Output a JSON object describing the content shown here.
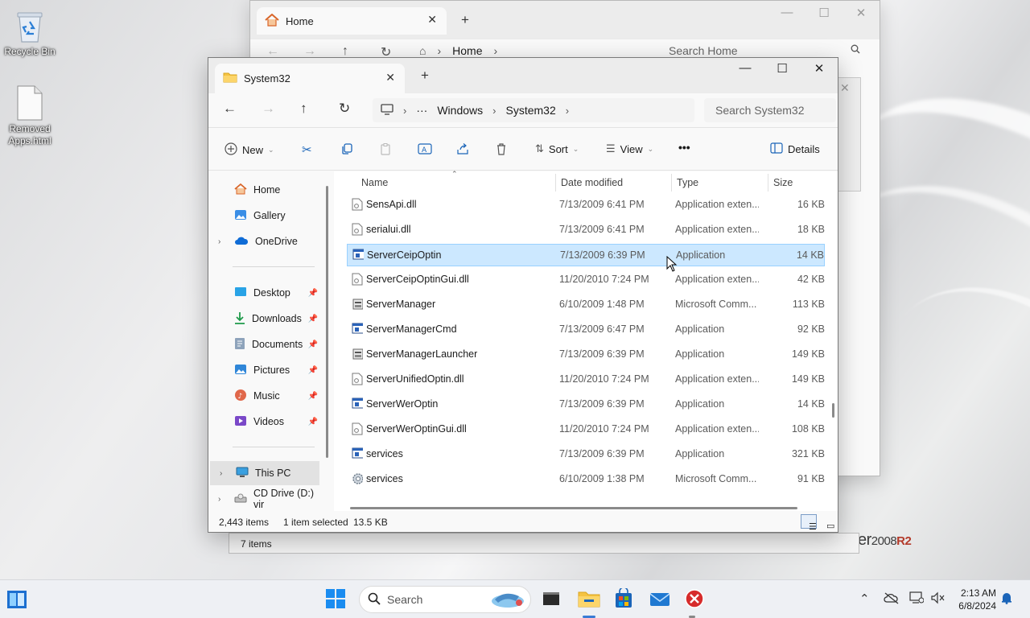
{
  "desktop": {
    "icons": [
      {
        "label": "Recycle Bin",
        "icon": "recycle-bin-icon"
      },
      {
        "label": "Removed Apps.html",
        "icon": "html-file-icon"
      }
    ],
    "brand": {
      "prefix": "er",
      "year": "2008",
      "suffix": "R2"
    }
  },
  "background_window": {
    "tab_title": "Home",
    "breadcrumb": [
      "Home"
    ],
    "search_placeholder": "Search Home",
    "status": "7 items"
  },
  "window": {
    "tab_title": "System32",
    "breadcrumb": [
      "Windows",
      "System32"
    ],
    "search_placeholder": "Search System32",
    "toolbar": {
      "new": "New",
      "sort": "Sort",
      "view": "View",
      "more": "•••",
      "details": "Details"
    },
    "nav": {
      "home": "Home",
      "gallery": "Gallery",
      "onedrive": "OneDrive",
      "desktop": "Desktop",
      "downloads": "Downloads",
      "documents": "Documents",
      "pictures": "Pictures",
      "music": "Music",
      "videos": "Videos",
      "this_pc": "This PC",
      "cd_drive": "CD Drive (D:) vir"
    },
    "columns": {
      "name": "Name",
      "date": "Date modified",
      "type": "Type",
      "size": "Size"
    },
    "files": [
      {
        "name": "SensApi.dll",
        "date": "7/13/2009 6:41 PM",
        "type": "Application exten...",
        "size": "16 KB",
        "icon": "dll-file-icon"
      },
      {
        "name": "serialui.dll",
        "date": "7/13/2009 6:41 PM",
        "type": "Application exten...",
        "size": "18 KB",
        "icon": "dll-file-icon"
      },
      {
        "name": "ServerCeipOptin",
        "date": "7/13/2009 6:39 PM",
        "type": "Application",
        "size": "14 KB",
        "icon": "application-icon"
      },
      {
        "name": "ServerCeipOptinGui.dll",
        "date": "11/20/2010 7:24 PM",
        "type": "Application exten...",
        "size": "42 KB",
        "icon": "dll-file-icon"
      },
      {
        "name": "ServerManager",
        "date": "6/10/2009 1:48 PM",
        "type": "Microsoft Comm...",
        "size": "113 KB",
        "icon": "msc-file-icon"
      },
      {
        "name": "ServerManagerCmd",
        "date": "7/13/2009 6:47 PM",
        "type": "Application",
        "size": "92 KB",
        "icon": "application-icon"
      },
      {
        "name": "ServerManagerLauncher",
        "date": "7/13/2009 6:39 PM",
        "type": "Application",
        "size": "149 KB",
        "icon": "msc-file-icon"
      },
      {
        "name": "ServerUnifiedOptin.dll",
        "date": "11/20/2010 7:24 PM",
        "type": "Application exten...",
        "size": "149 KB",
        "icon": "dll-file-icon"
      },
      {
        "name": "ServerWerOptin",
        "date": "7/13/2009 6:39 PM",
        "type": "Application",
        "size": "14 KB",
        "icon": "application-icon"
      },
      {
        "name": "ServerWerOptinGui.dll",
        "date": "11/20/2010 7:24 PM",
        "type": "Application exten...",
        "size": "108 KB",
        "icon": "dll-file-icon"
      },
      {
        "name": "services",
        "date": "7/13/2009 6:39 PM",
        "type": "Application",
        "size": "321 KB",
        "icon": "application-icon"
      },
      {
        "name": "services",
        "date": "6/10/2009 1:38 PM",
        "type": "Microsoft Comm...",
        "size": "91 KB",
        "icon": "services-gear-icon"
      }
    ],
    "selected_index": 2,
    "status": {
      "count": "2,443 items",
      "selected": "1 item selected",
      "size": "13.5 KB"
    }
  },
  "taskbar": {
    "search_placeholder": "Search",
    "time": "2:13 AM",
    "date": "6/8/2024"
  },
  "colors": {
    "accent": "#0067c0",
    "selection": "#cce8ff",
    "folder": "#f5c342"
  }
}
